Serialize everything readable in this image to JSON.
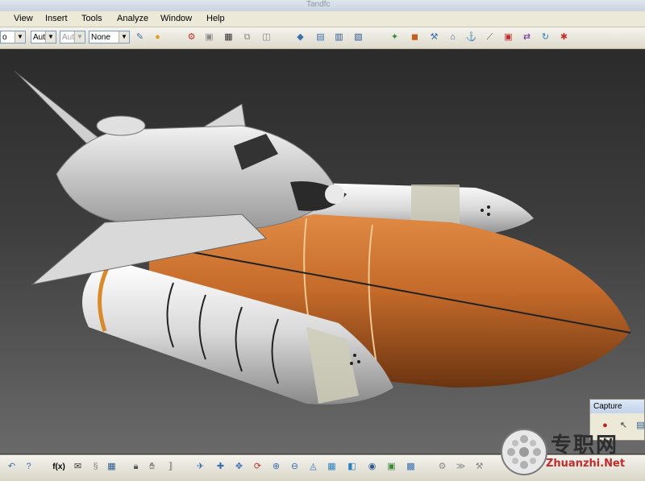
{
  "window": {
    "title": "Tandfc"
  },
  "menu": [
    {
      "label": "View"
    },
    {
      "label": "Insert"
    },
    {
      "label": "Tools"
    },
    {
      "label": "Analyze"
    },
    {
      "label": "Window"
    },
    {
      "label": "Help"
    }
  ],
  "toolbar": {
    "combo_partial": "o",
    "combo_auto_1": "Aut",
    "combo_auto_2": "Aut",
    "combo_none": "None",
    "icons": [
      "painter-icon",
      "material-icon",
      "measure-icon",
      "freeze-icon",
      "image-icon",
      "copy-icon",
      "sketch-icon",
      "cube-icon",
      "pattern-icon",
      "catalog-icon",
      "catalog-icon-2",
      "tool-icon",
      "part-icon",
      "joint-icon",
      "snap-icon",
      "clip-icon",
      "rotate-icon",
      "quick-icon",
      "swap-icon",
      "settings-icon"
    ]
  },
  "viewport": {
    "model_colors": {
      "orbiter": "#d9d9d9",
      "tank": "#c46a2a",
      "boosters": "#e6e6e6"
    }
  },
  "bottom_toolbar": {
    "formula_label": "f(x)",
    "icons": [
      "undo-icon",
      "whats-this-icon",
      "formula-icon",
      "comment-icon",
      "table-icon",
      "lock-icon",
      "param-icon",
      "fly-icon",
      "pan-icon",
      "rotate-view-icon",
      "zoom-in-icon",
      "zoom-out-icon",
      "normal-view-icon",
      "iso-view-icon",
      "cube-view-icon",
      "shading-icon",
      "hide-show-icon",
      "swap-visible-icon",
      "tree-icon",
      "measure-icon",
      "select-icon"
    ]
  },
  "capture_panel": {
    "title": "Capture"
  },
  "watermark": {
    "chinese": "专职网",
    "english": "Zhuanzhi.Net"
  }
}
